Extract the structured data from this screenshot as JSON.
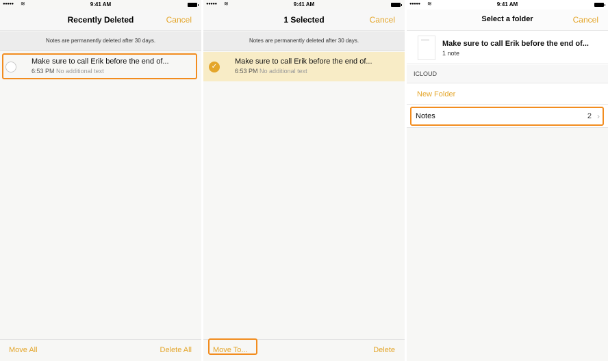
{
  "status": {
    "time": "9:41 AM",
    "signal": "●●●●●",
    "wifi": "wifi-icon"
  },
  "screen1": {
    "title": "Recently Deleted",
    "cancel": "Cancel",
    "notice": "Notes are permanently deleted after 30 days.",
    "note": {
      "title": "Make sure to call Erik before the end of...",
      "time": "6:53 PM",
      "detail": "No additional text"
    },
    "toolbar": {
      "left": "Move All",
      "right": "Delete All"
    }
  },
  "screen2": {
    "title": "1 Selected",
    "cancel": "Cancel",
    "notice": "Notes are permanently deleted after 30 days.",
    "note": {
      "title": "Make sure to call Erik before the end of...",
      "time": "6:53 PM",
      "detail": "No additional text"
    },
    "toolbar": {
      "left": "Move To...",
      "right": "Delete"
    }
  },
  "screen3": {
    "title": "Select a folder",
    "cancel": "Cancel",
    "note": {
      "title": "Make sure to call Erik before the end of...",
      "count": "1 note"
    },
    "section": "ICLOUD",
    "new_folder": "New Folder",
    "folder": {
      "name": "Notes",
      "count": "2"
    }
  },
  "colors": {
    "accent": "#e4a62b",
    "highlight": "#f28c1e",
    "selected_row": "#f8ecc6"
  }
}
